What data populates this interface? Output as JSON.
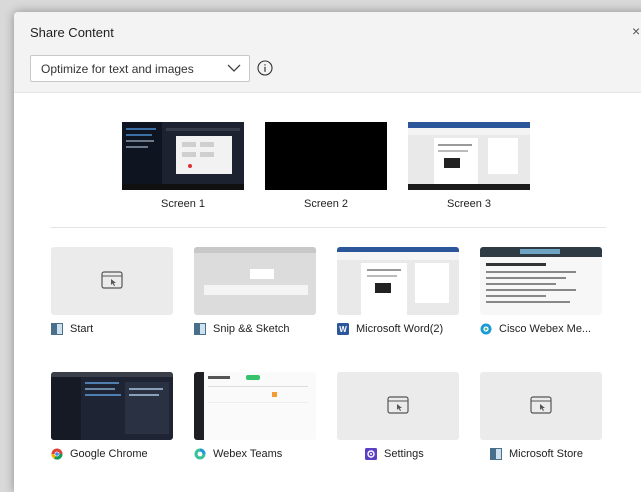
{
  "dialog": {
    "title": "Share Content",
    "close_glyph": "×",
    "optimize_select": {
      "value": "Optimize for text and images"
    }
  },
  "screens": [
    {
      "label": "Screen 1"
    },
    {
      "label": "Screen 2"
    },
    {
      "label": "Screen 3"
    }
  ],
  "apps": [
    {
      "label": "Start",
      "icon": "window-icon"
    },
    {
      "label": "Snip && Sketch",
      "icon": "window-icon"
    },
    {
      "label": "Microsoft Word(2)",
      "icon": "word-icon"
    },
    {
      "label": "Cisco Webex Me...",
      "icon": "webex-icon"
    },
    {
      "label": "Google Chrome",
      "icon": "chrome-icon"
    },
    {
      "label": "Webex Teams",
      "icon": "webex-teams-icon"
    },
    {
      "label": "Settings",
      "icon": "settings-icon"
    },
    {
      "label": "Microsoft Store",
      "icon": "window-icon"
    }
  ],
  "colors": {
    "header_bg": "#f3f3f3",
    "tile_blank": "#ebebeb",
    "word_blue": "#2b579a",
    "settings_purple": "#5b3fc4"
  }
}
